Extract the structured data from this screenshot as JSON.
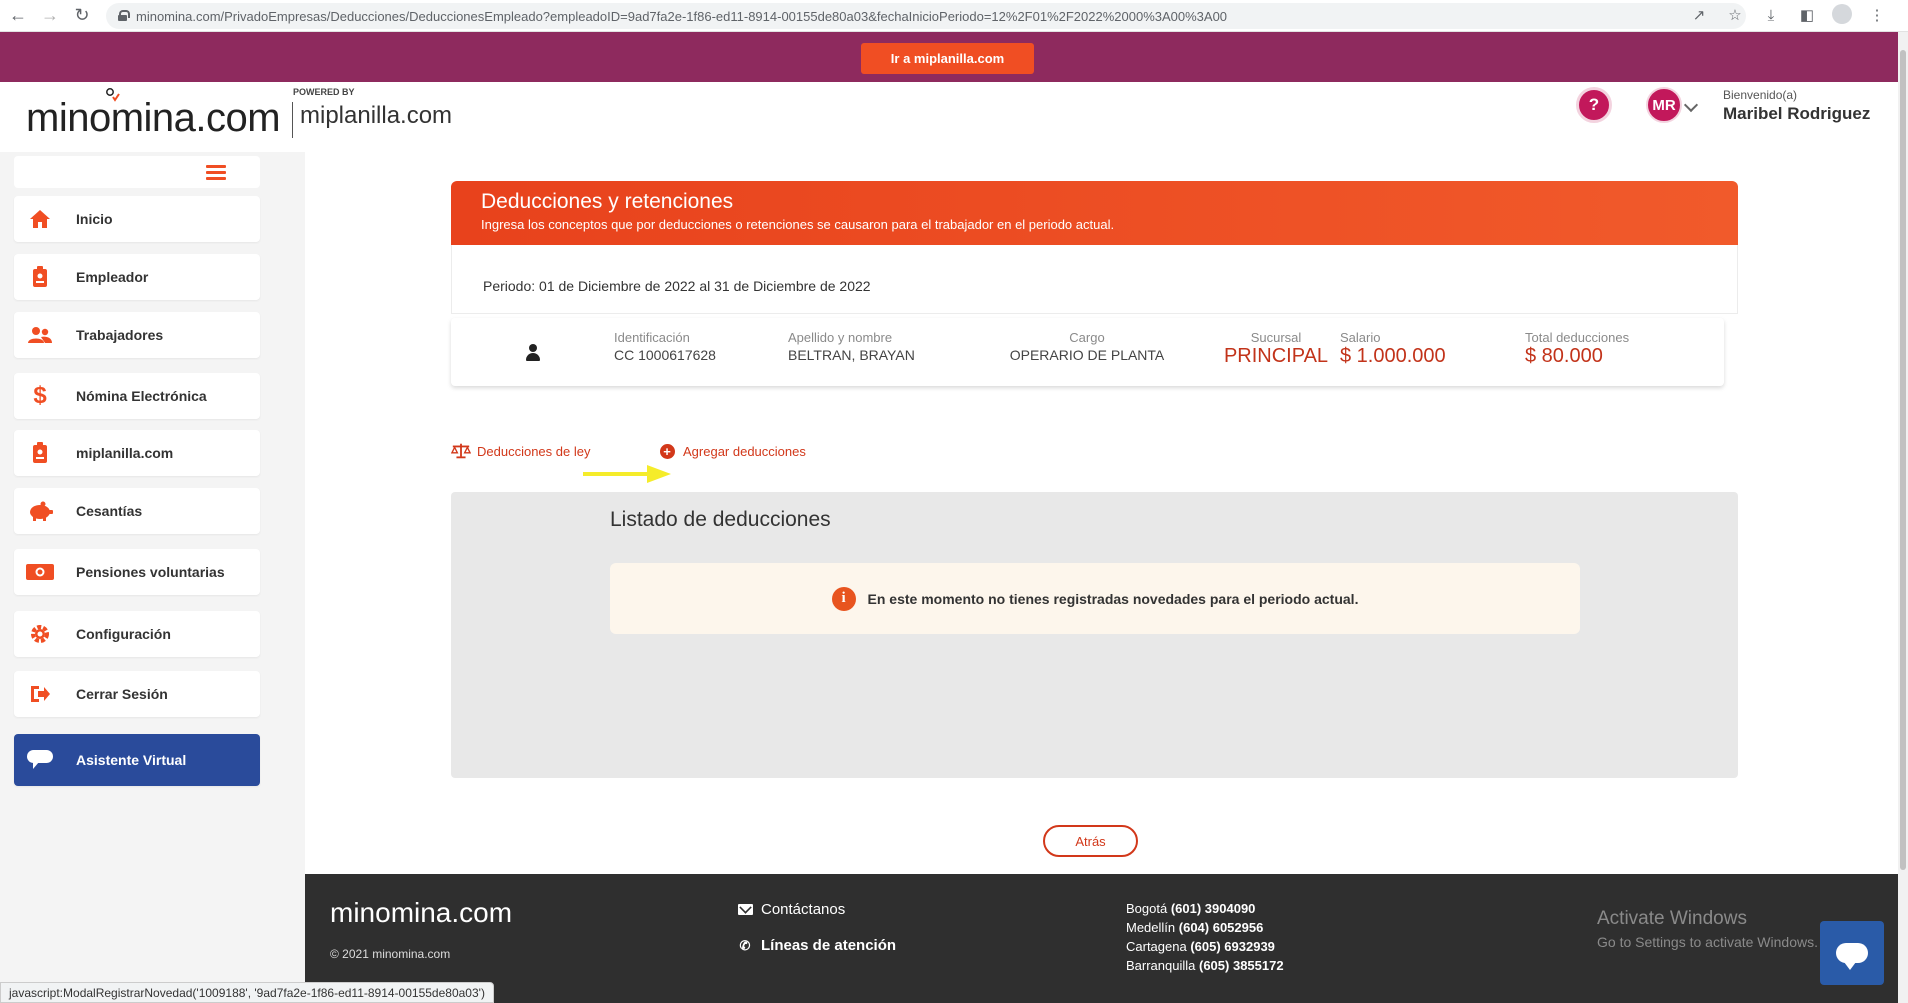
{
  "browser": {
    "url": "minomina.com/PrivadoEmpresas/Deducciones/DeduccionesEmpleado?empleadoID=9ad7fa2e-1f86-ed11-8914-00155de80a03&fechaInicioPeriodo=12%2F01%2F2022%2000%3A00%3A00"
  },
  "promo": {
    "button_label": "Ir a miplanilla.com"
  },
  "header": {
    "logo": "minomina.com",
    "powered_by": "POWERED BY",
    "partner_logo": "miplanilla.com",
    "avatar_initials": "MR",
    "welcome": "Bienvenido(a)",
    "user_name": "Maribel Rodriguez"
  },
  "sidebar": {
    "items": [
      {
        "label": "Inicio",
        "icon": "home-icon"
      },
      {
        "label": "Empleador",
        "icon": "badge-icon"
      },
      {
        "label": "Trabajadores",
        "icon": "users-icon"
      },
      {
        "label": "Nómina Electrónica",
        "icon": "dollar-icon"
      },
      {
        "label": "miplanilla.com",
        "icon": "badge-icon"
      },
      {
        "label": "Cesantías",
        "icon": "piggy-bank-icon"
      },
      {
        "label": "Pensiones voluntarias",
        "icon": "money-icon"
      },
      {
        "label": "Configuración",
        "icon": "gear-icon"
      },
      {
        "label": "Cerrar Sesión",
        "icon": "logout-icon"
      },
      {
        "label": "Asistente Virtual",
        "icon": "chat-icon"
      }
    ]
  },
  "main": {
    "title": "Deducciones y retenciones",
    "subtitle": "Ingresa los conceptos que por deducciones o retenciones se causaron para el trabajador en el periodo actual.",
    "period": "Periodo: 01 de Diciembre de 2022 al 31 de Diciembre de 2022",
    "employee": {
      "id_label": "Identificación",
      "id_value": "CC 1000617628",
      "name_label": "Apellido y nombre",
      "name_value": "BELTRAN, BRAYAN",
      "role_label": "Cargo",
      "role_value": "OPERARIO DE PLANTA",
      "branch_label": "Sucursal",
      "branch_value": "PRINCIPAL",
      "salary_label": "Salario",
      "salary_value": "$ 1.000.000",
      "total_label": "Total deducciones",
      "total_value": "$ 80.000"
    },
    "actions": {
      "legal": "Deducciones de ley",
      "add": "Agregar deducciones"
    },
    "listing": {
      "title": "Listado de deducciones",
      "empty_message": "En este momento no tienes registradas novedades para el periodo actual."
    },
    "back_label": "Atrás"
  },
  "footer": {
    "logo": "minomina.com",
    "copyright": "© 2021 minomina.com",
    "contact": "Contáctanos",
    "lines": "Líneas de atención",
    "phones": [
      {
        "city": "Bogotá",
        "number": "(601) 3904090"
      },
      {
        "city": "Medellín",
        "number": "(604) 6052956"
      },
      {
        "city": "Cartagena",
        "number": "(605) 6932939"
      },
      {
        "city": "Barranquilla",
        "number": "(605) 3855172"
      }
    ],
    "activate_title": "Activate Windows",
    "activate_sub": "Go to Settings to activate Windows."
  },
  "status_bar": "javascript:ModalRegistrarNovedad('1009188', '9ad7fa2e-1f86-ed11-8914-00155de80a03')",
  "colors": {
    "brand_orange": "#f04e23",
    "promo_purple": "#8e2a5e",
    "accent_magenta": "#c2185b",
    "virtual_blue": "#2a4b9b"
  }
}
